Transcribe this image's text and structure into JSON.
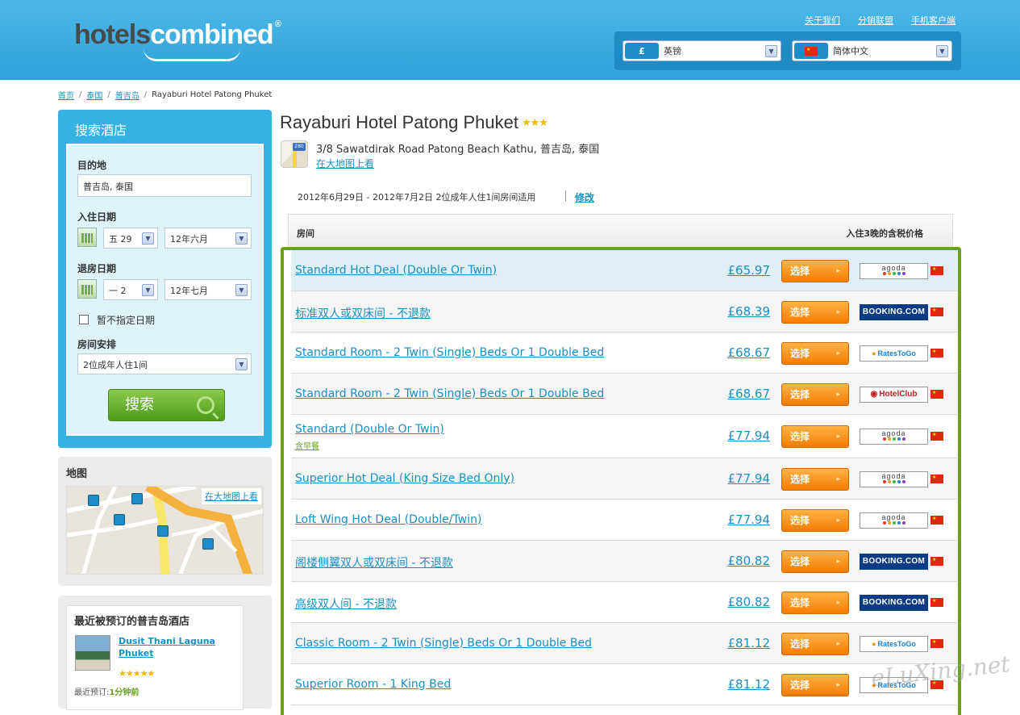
{
  "header": {
    "logo_part1": "hotels",
    "logo_part2": "combined",
    "logo_reg": "®",
    "links": [
      "关于我们",
      "分销联盟",
      "手机客户端"
    ],
    "currency": {
      "symbol": "£",
      "label": "英镑"
    },
    "language": {
      "label": "简体中文"
    }
  },
  "breadcrumb": [
    "首页",
    "泰国",
    "普吉岛"
  ],
  "breadcrumb_current": "Rayaburi Hotel Patong Phuket",
  "search": {
    "title": "搜索酒店",
    "destination_label": "目的地",
    "destination_value": "普吉岛, 泰国",
    "checkin_label": "入住日期",
    "checkin_day": "五 29",
    "checkin_month": "12年六月",
    "checkout_label": "退房日期",
    "checkout_day": "一 2",
    "checkout_month": "12年七月",
    "no_dates_label": "暂不指定日期",
    "room_label": "房间安排",
    "room_value": "2位成年人住1间",
    "search_button": "搜索"
  },
  "map": {
    "title": "地图",
    "large_map_link": "在大地图上看"
  },
  "recent": {
    "title": "最近被预订的普吉岛酒店",
    "hotel_name": "Dusit Thani Laguna Phuket",
    "stars": "★★★★★",
    "booked_label": "最近预订:",
    "booked_time": "1分钟前"
  },
  "hotel": {
    "name": "Rayaburi Hotel Patong Phuket",
    "stars": "★★★",
    "address": "3/8 Sawatdirak Road Patong Beach Kathu, 普吉岛, 泰国",
    "map_link": "在大地图上看",
    "map_shield": "280",
    "date_line": "2012年6月29日 - 2012年7月2日 2位成年人住1间房间适用",
    "edit_link": "修改"
  },
  "table": {
    "col_room": "房间",
    "col_price": "入住3晚的含税价格",
    "select_label": "选择",
    "rows": [
      {
        "name": "Standard Hot Deal (Double Or Twin)",
        "sub": "",
        "price": "£65.97",
        "provider": "agoda"
      },
      {
        "name": "标准双人或双床间 - 不退款",
        "sub": "",
        "price": "£68.39",
        "provider": "booking"
      },
      {
        "name": "Standard Room - 2 Twin (Single) Beds Or 1 Double Bed",
        "sub": "",
        "price": "£68.67",
        "provider": "ratestogo"
      },
      {
        "name": "Standard Room - 2 Twin (Single) Beds Or 1 Double Bed",
        "sub": "",
        "price": "£68.67",
        "provider": "hotelclub"
      },
      {
        "name": "Standard (Double Or Twin)",
        "sub": "含早餐",
        "price": "£77.94",
        "provider": "agoda"
      },
      {
        "name": "Superior Hot Deal (King Size Bed Only)",
        "sub": "",
        "price": "£77.94",
        "provider": "agoda"
      },
      {
        "name": "Loft Wing Hot Deal (Double/Twin)",
        "sub": "",
        "price": "£77.94",
        "provider": "agoda"
      },
      {
        "name": "阁楼侧翼双人或双床间 - 不退款",
        "sub": "",
        "price": "£80.82",
        "provider": "booking"
      },
      {
        "name": "高级双人间 - 不退款",
        "sub": "",
        "price": "£80.82",
        "provider": "booking"
      },
      {
        "name": "Classic Room - 2 Twin (Single) Beds Or 1 Double Bed",
        "sub": "",
        "price": "£81.12",
        "provider": "ratestogo"
      },
      {
        "name": "Superior Room - 1 King Bed",
        "sub": "",
        "price": "£81.12",
        "provider": "ratestogo"
      }
    ],
    "provider_labels": {
      "agoda": "agoda",
      "booking": "BOOKING.COM",
      "ratestogo": "RatesToGo",
      "hotelclub": "HotelClub"
    }
  },
  "watermark": "eLuXing.net"
}
